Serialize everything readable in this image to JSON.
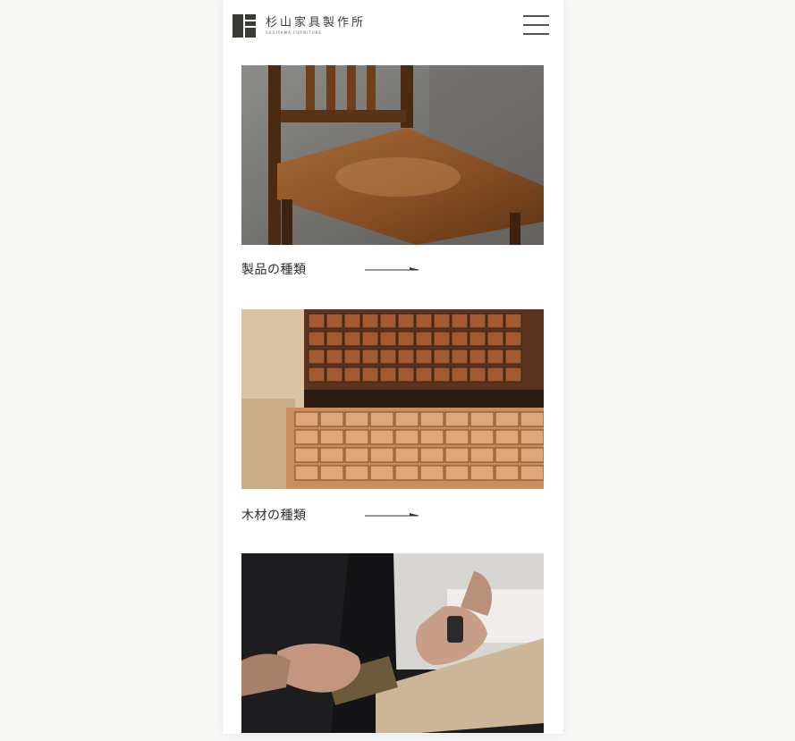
{
  "brand": {
    "name": "杉山家具製作所",
    "subtitle": "SUGIYAMA FURNITURE"
  },
  "icons": {
    "logo": "logo-mark-icon",
    "menu": "hamburger-menu-icon",
    "arrow": "arrow-right-icon"
  },
  "colors": {
    "accent": "#3b3b36",
    "background": "#f7f7f6"
  },
  "cards": [
    {
      "label": "製品の種類",
      "image": "wooden chair photo"
    },
    {
      "label": "木材の種類",
      "image": "stacked lumber photo"
    },
    {
      "label": "",
      "image": "hands working wood photo"
    }
  ]
}
